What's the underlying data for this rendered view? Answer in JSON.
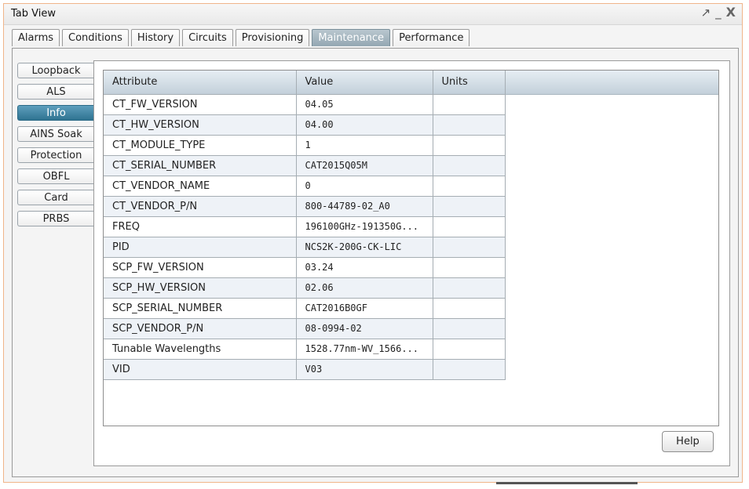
{
  "window": {
    "title": "Tab View",
    "controls": {
      "float": "↗",
      "minimize": "_",
      "close": "X"
    }
  },
  "tabs": [
    {
      "label": "Alarms",
      "active": false
    },
    {
      "label": "Conditions",
      "active": false
    },
    {
      "label": "History",
      "active": false
    },
    {
      "label": "Circuits",
      "active": false
    },
    {
      "label": "Provisioning",
      "active": false
    },
    {
      "label": "Maintenance",
      "active": true
    },
    {
      "label": "Performance",
      "active": false
    }
  ],
  "side_tabs": [
    {
      "label": "Loopback",
      "active": false
    },
    {
      "label": "ALS",
      "active": false
    },
    {
      "label": "Info",
      "active": true
    },
    {
      "label": "AINS Soak",
      "active": false
    },
    {
      "label": "Protection",
      "active": false
    },
    {
      "label": "OBFL",
      "active": false
    },
    {
      "label": "Card",
      "active": false
    },
    {
      "label": "PRBS",
      "active": false
    }
  ],
  "table": {
    "columns": [
      "Attribute",
      "Value",
      "Units"
    ],
    "rows": [
      [
        "CT_FW_VERSION",
        "04.05",
        ""
      ],
      [
        "CT_HW_VERSION",
        "04.00",
        ""
      ],
      [
        "CT_MODULE_TYPE",
        "1",
        ""
      ],
      [
        "CT_SERIAL_NUMBER",
        "CAT2015Q05M",
        ""
      ],
      [
        "CT_VENDOR_NAME",
        "0",
        ""
      ],
      [
        "CT_VENDOR_P/N",
        "800-44789-02_A0",
        ""
      ],
      [
        "FREQ",
        "196100GHz-191350G...",
        ""
      ],
      [
        "PID",
        "NCS2K-200G-CK-LIC",
        ""
      ],
      [
        "SCP_FW_VERSION",
        "03.24",
        ""
      ],
      [
        "SCP_HW_VERSION",
        "02.06",
        ""
      ],
      [
        "SCP_SERIAL_NUMBER",
        "CAT2016B0GF",
        ""
      ],
      [
        "SCP_VENDOR_P/N",
        "08-0994-02",
        ""
      ],
      [
        "Tunable Wavelengths",
        "1528.77nm-WV_1566...",
        ""
      ],
      [
        "VID",
        "V03",
        ""
      ]
    ]
  },
  "buttons": {
    "help": "Help"
  },
  "colors": {
    "active_tab": "#94a7b2",
    "active_side_tab": "#2f7391",
    "window_border": "#f0b58a",
    "header": "#c3d0da"
  }
}
